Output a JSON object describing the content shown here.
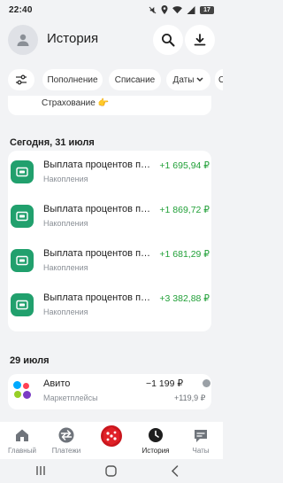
{
  "status_bar": {
    "time": "22:40",
    "battery": "17"
  },
  "header": {
    "title": "История"
  },
  "filters": {
    "chips": [
      "Пополнение",
      "Списание",
      "Даты",
      "О"
    ]
  },
  "top_card": {
    "text": "Страхование 👉"
  },
  "sections": [
    {
      "date": "Сегодня, 31 июля",
      "transactions": [
        {
          "title": "Выплата процентов по вкладу",
          "subtitle": "Накопления",
          "amount": "+1 695,94 ₽"
        },
        {
          "title": "Выплата процентов по вкладу",
          "subtitle": "Накопления",
          "amount": "+1 869,72 ₽"
        },
        {
          "title": "Выплата процентов по вкладу",
          "subtitle": "Накопления",
          "amount": "+1 681,29 ₽"
        },
        {
          "title": "Выплата процентов по вкладу",
          "subtitle": "Накопления",
          "amount": "+3 382,88 ₽"
        }
      ]
    },
    {
      "date": "29 июля",
      "transactions": [
        {
          "title": "Авито",
          "subtitle": "Маркетплейсы",
          "amount": "−1 199 ₽",
          "cashback": "+119,9 ₽"
        }
      ]
    }
  ],
  "bottom_nav": {
    "items": [
      {
        "label": "Главный",
        "icon": "home-icon"
      },
      {
        "label": "Платежи",
        "icon": "transfer-arrows-icon"
      },
      {
        "label": "",
        "icon": "dice-icon"
      },
      {
        "label": "История",
        "icon": "clock-icon"
      },
      {
        "label": "Чаты",
        "icon": "chat-icon"
      }
    ]
  },
  "colors": {
    "accent": "#21a038",
    "icon_green": "#21a06d",
    "background": "#f2f3f5"
  }
}
